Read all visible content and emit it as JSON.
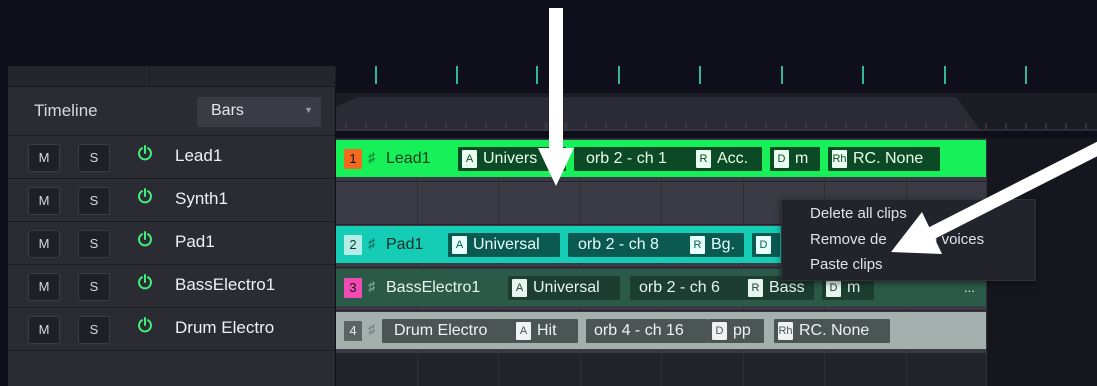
{
  "timeline": {
    "label": "Timeline",
    "unit_selected": "Bars"
  },
  "tracks": [
    {
      "mute": "M",
      "solo": "S",
      "name": "Lead1"
    },
    {
      "mute": "M",
      "solo": "S",
      "name": "Synth1"
    },
    {
      "mute": "M",
      "solo": "S",
      "name": "Pad1"
    },
    {
      "mute": "M",
      "solo": "S",
      "name": "BassElectro1"
    },
    {
      "mute": "M",
      "solo": "S",
      "name": "Drum Electro"
    }
  ],
  "clips": {
    "lead": {
      "num": "1",
      "name": "Lead1",
      "a_key": "A",
      "a_val": "Univers",
      "channel": "orb 2 - ch 1",
      "r_key": "R",
      "r_val": "Acc.",
      "d_key": "D",
      "d_val": "m",
      "rh_key": "Rh",
      "rh_val": "RC. None"
    },
    "pad": {
      "num": "2",
      "name": "Pad1",
      "a_key": "A",
      "a_val": "Universal",
      "channel": "orb 2 - ch 8",
      "r_key": "R",
      "r_val": "Bg.",
      "d_key": "D"
    },
    "bass": {
      "num": "3",
      "name": "BassElectro1",
      "a_key": "A",
      "a_val": "Universal",
      "channel": "orb 2 - ch 6",
      "r_key": "R",
      "r_val": "Bass",
      "d_key": "D",
      "d_val": "m",
      "more": "..."
    },
    "drum": {
      "num": "4",
      "name": "Drum Electro",
      "a_key": "A",
      "a_val": "Hit",
      "channel": "orb 4 - ch 16",
      "d_key": "D",
      "d_val": "pp",
      "rh_key": "Rh",
      "rh_val": "RC. None"
    }
  },
  "context_menu": {
    "items": [
      "Delete all clips",
      "Remove de",
      "ng voices",
      "Paste clips"
    ]
  },
  "colors": {
    "lead_clip": "#18f05a",
    "pad_clip": "#14cdb4",
    "bass_clip": "#2c5a48",
    "drum_clip": "#a3b0ae",
    "lead_num": "#f26a1d",
    "pad_num": "#b7ece8",
    "bass_num": "#f04ab3"
  }
}
